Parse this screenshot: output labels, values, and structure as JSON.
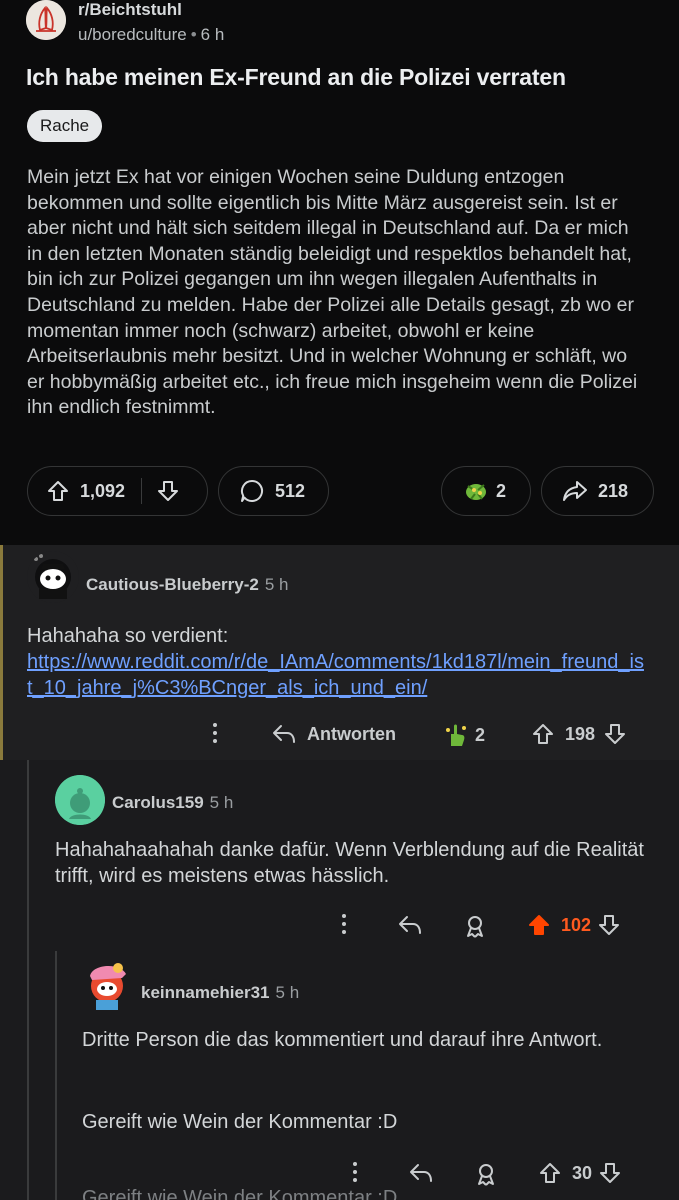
{
  "post": {
    "subreddit": "r/Beichtstuhl",
    "author": "u/boredculture",
    "age": "6 h",
    "title": "Ich habe meinen Ex-Freund an die Polizei verraten",
    "flair": "Rache",
    "body": "Mein jetzt Ex hat vor einigen Wochen seine Duldung entzogen bekommen und sollte eigentlich bis Mitte März ausgereist sein. Ist er aber nicht und hält sich seitdem illegal in Deutschland auf. Da er mich in den letzten Monaten ständig beleidigt und respektlos behandelt hat, bin ich zur Polizei gegangen um ihn wegen illegalen Aufenthalts in Deutschland zu melden. Habe der Polizei alle Details gesagt, zb wo er momentan immer noch (schwarz) arbeitet, obwohl er keine Arbeitserlaubnis mehr besitzt. Und in welcher Wohnung er schläft, wo er hobbymäßig arbeitet etc., ich freue mich insgeheim wenn die Polizei ihn endlich festnimmt.",
    "upvotes": "1,092",
    "comments": "512",
    "awards": "2",
    "shares": "218",
    "icons": {
      "avatar": "praying-hands-icon",
      "upvote": "arrow-up-icon",
      "downvote": "arrow-down-icon",
      "comment": "speech-bubble-icon",
      "award": "award-icon",
      "share": "share-arrow-icon"
    }
  },
  "comments": [
    {
      "user": "Cautious-Blueberry-2",
      "age": "5 h",
      "text": "Hahahaha so verdient:",
      "link": "https://www.reddit.com/r/de_IAmA/comments/1kd187l/mein_freund_ist_10_jahre_j%C3%BCnger_als_ich_und_ein/",
      "reply_label": "Antworten",
      "awards": "2",
      "score": "198"
    },
    {
      "user": "Carolus159",
      "age": "5 h",
      "text": "Hahahahaahahah danke dafür. Wenn Verblendung auf die Realität trifft, wird es meistens etwas hässlich.",
      "score": "102",
      "upvoted": true,
      "upvote_color": "#ff4500"
    },
    {
      "user": "keinnamehier31",
      "age": "5 h",
      "text": "Dritte Person die das kommentiert und darauf ihre Antwort.",
      "text2": "Gereift wie Wein der Kommentar :D",
      "score": "30"
    }
  ],
  "colors": {
    "background": "#0b0b0c",
    "comment_background": "#1b1b1d",
    "link": "#6fa0ff",
    "highlight_border": "#8a7a3c",
    "flair_background": "#e7e9eb"
  }
}
